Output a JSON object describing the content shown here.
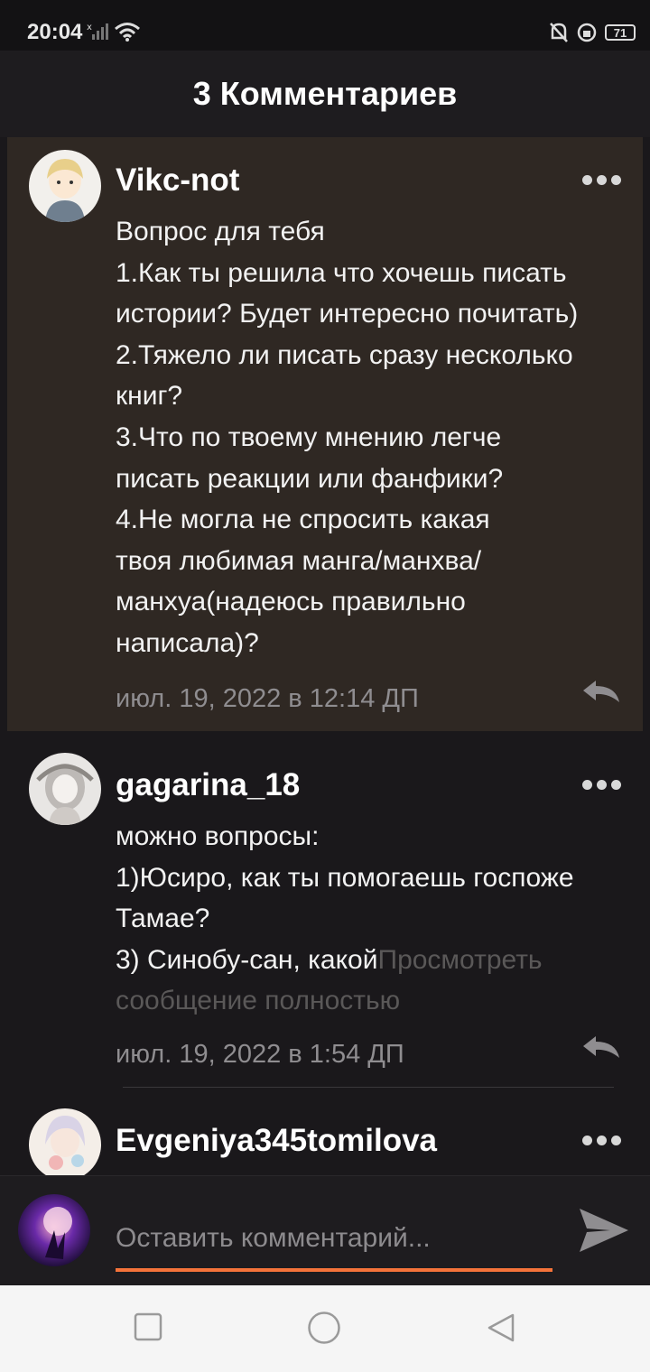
{
  "status_bar": {
    "time": "20:04",
    "battery": "71"
  },
  "header": {
    "title": "3 Комментариев"
  },
  "comments": [
    {
      "username": "Vikc-not",
      "lines": [
        "Вопрос для тебя",
        "1.Как ты решила что хочешь писать",
        "истории? Будет интересно почитать)",
        "2.Тяжело ли писать сразу несколько",
        "книг?",
        "3.Что по твоему мнению легче",
        "писать реакции или фанфики?",
        "4.Не могла не спросить какая",
        "твоя любимая манга/манхва/",
        "манхуа(надеюсь правильно",
        "написала)?"
      ],
      "timestamp": "июл. 19, 2022 в 12:14 ДП"
    },
    {
      "username": "gagarina_18",
      "lines": [
        "можно вопросы:",
        "1)Юсиро, как ты помогаешь госпоже",
        "Тамае?",
        "3) Синобу-сан, какой"
      ],
      "read_more": "Просмотреть",
      "read_more_2": "сообщение полностью",
      "timestamp": "июл. 19, 2022 в 1:54 ДП"
    },
    {
      "username": "Evgeniya345tomilova"
    }
  ],
  "composer": {
    "placeholder": "Оставить комментарий..."
  },
  "colors": {
    "accent": "#f5733a",
    "highlight_bg": "#2f2823",
    "background": "#1a181b"
  }
}
